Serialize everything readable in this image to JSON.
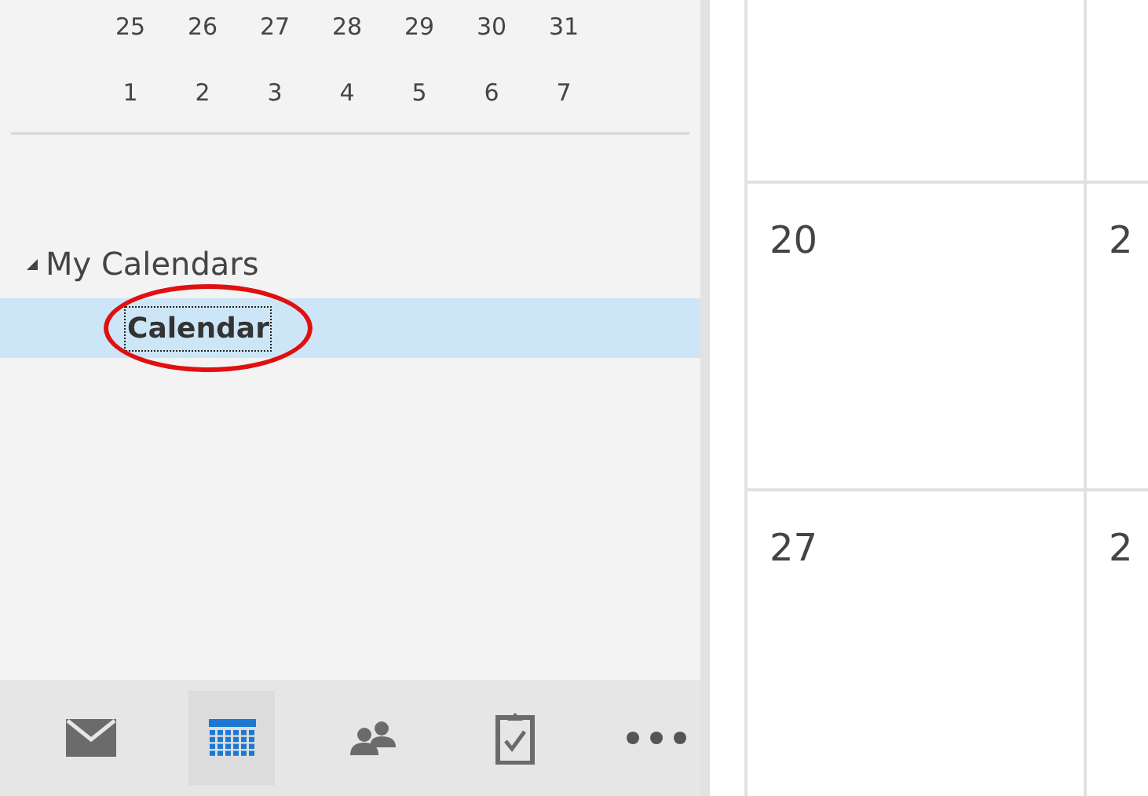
{
  "mini_calendar": {
    "weeks": [
      [
        "25",
        "26",
        "27",
        "28",
        "29",
        "30",
        "31"
      ],
      [
        "1",
        "2",
        "3",
        "4",
        "5",
        "6",
        "7"
      ]
    ]
  },
  "folder_group": {
    "label": "My Calendars",
    "expanded": true,
    "items": [
      {
        "label": "Calendar",
        "selected": true,
        "focused": true,
        "circled": true
      }
    ]
  },
  "nav_bar": {
    "items": [
      {
        "kind": "mail",
        "selected": false
      },
      {
        "kind": "calendar",
        "selected": true
      },
      {
        "kind": "people",
        "selected": false
      },
      {
        "kind": "tasks",
        "selected": false
      },
      {
        "kind": "more",
        "selected": false
      }
    ]
  },
  "month_grid": {
    "weeks": [
      {
        "days": [
          "20",
          "2"
        ]
      },
      {
        "days": [
          "27",
          "2"
        ]
      }
    ]
  }
}
